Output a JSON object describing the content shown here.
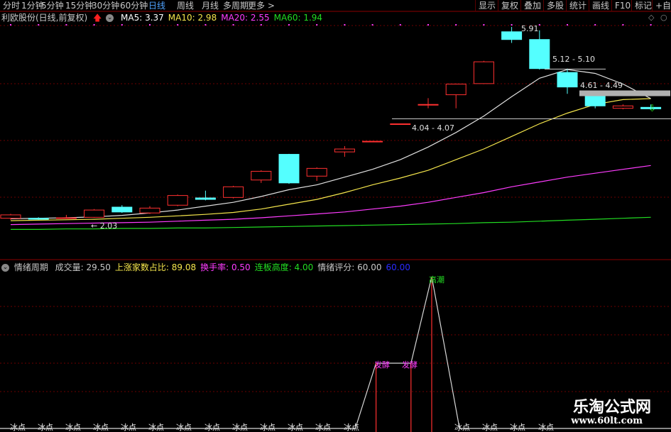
{
  "menu": {
    "tabs": [
      "分时",
      "1分钟",
      "5分钟",
      "15分钟",
      "30分钟",
      "60分钟",
      "日线",
      "周线",
      "月线",
      "多周期",
      "更多 >"
    ],
    "active_tab": "日线",
    "right_buttons": [
      "显示",
      "复权",
      "叠加",
      "多股",
      "统计",
      "画线",
      "F10",
      "标记",
      "+自选"
    ]
  },
  "main_panel": {
    "stock_name": "利欧股份(日线,前复权)",
    "ma": [
      {
        "label": "MA5: 3.37",
        "color": "#ffffff"
      },
      {
        "label": "MA10: 2.98",
        "color": "#f5e64c"
      },
      {
        "label": "MA20: 2.55",
        "color": "#ff3cff"
      },
      {
        "label": "MA60: 1.94",
        "color": "#22dd22"
      }
    ],
    "annotations": [
      "5.91",
      "5.12 - 5.10",
      "4.61 - 4.49",
      "4.04 - 4.07",
      "← 2.03"
    ]
  },
  "lower_panel": {
    "title": "情绪周期",
    "stats": [
      {
        "label": "成交量: 29.50",
        "color": "#c8c8c8"
      },
      {
        "label": "上涨家数占比: 89.08",
        "color": "#f5e64c"
      },
      {
        "label": "换手率: 0.50",
        "color": "#ff3cff"
      },
      {
        "label": "连板高度: 4.00",
        "color": "#22dd22"
      },
      {
        "label": "情绪评分: 60.00",
        "color": "#c8c8c8"
      },
      {
        "label": "60.00",
        "color": "#2a2aff"
      }
    ],
    "phase_labels": {
      "ice": "冰点",
      "ferment": "发酵",
      "climax": "高潮"
    }
  },
  "chart_data": {
    "type": "candlestick",
    "candles": [
      {
        "o": 2.03,
        "c": 2.1,
        "h": 2.12,
        "l": 2.0
      },
      {
        "o": 2.03,
        "c": 2.01,
        "h": 2.05,
        "l": 2.0
      },
      {
        "o": 2.03,
        "c": 2.04,
        "h": 2.1,
        "l": 2.02
      },
      {
        "o": 2.05,
        "c": 2.2,
        "h": 2.22,
        "l": 2.04
      },
      {
        "o": 2.26,
        "c": 2.16,
        "h": 2.3,
        "l": 2.14
      },
      {
        "o": 2.14,
        "c": 2.24,
        "h": 2.28,
        "l": 2.12
      },
      {
        "o": 2.3,
        "c": 2.5,
        "h": 2.52,
        "l": 2.28
      },
      {
        "o": 2.45,
        "c": 2.42,
        "h": 2.6,
        "l": 2.4
      },
      {
        "o": 2.46,
        "c": 2.68,
        "h": 2.7,
        "l": 2.44
      },
      {
        "o": 2.82,
        "c": 3.0,
        "h": 3.02,
        "l": 2.76
      },
      {
        "o": 3.35,
        "c": 2.76,
        "h": 3.36,
        "l": 2.74
      },
      {
        "o": 2.9,
        "c": 3.06,
        "h": 3.08,
        "l": 2.8
      },
      {
        "o": 3.4,
        "c": 3.46,
        "h": 3.52,
        "l": 3.3
      },
      {
        "o": 3.62,
        "c": 3.62,
        "h": 3.62,
        "l": 3.62
      },
      {
        "o": 3.98,
        "c": 3.98,
        "h": 3.98,
        "l": 3.98
      },
      {
        "o": 4.38,
        "c": 4.38,
        "h": 4.51,
        "l": 4.3
      },
      {
        "o": 4.58,
        "c": 4.8,
        "h": 4.81,
        "l": 4.3
      },
      {
        "o": 4.81,
        "c": 5.26,
        "h": 5.28,
        "l": 4.8
      },
      {
        "o": 5.88,
        "c": 5.72,
        "h": 5.98,
        "l": 5.65
      },
      {
        "o": 5.72,
        "c": 5.12,
        "h": 5.91,
        "l": 5.1
      },
      {
        "o": 5.04,
        "c": 4.74,
        "h": 5.12,
        "l": 4.6
      },
      {
        "o": 4.61,
        "c": 4.35,
        "h": 4.64,
        "l": 4.3
      },
      {
        "o": 4.3,
        "c": 4.35,
        "h": 4.38,
        "l": 4.28
      },
      {
        "o": 4.32,
        "c": 4.29,
        "h": 4.38,
        "l": 4.28
      }
    ],
    "ma5": [
      2.02,
      2.03,
      2.04,
      2.06,
      2.09,
      2.14,
      2.2,
      2.28,
      2.36,
      2.48,
      2.62,
      2.72,
      2.88,
      3.04,
      3.24,
      3.5,
      3.8,
      4.14,
      4.54,
      4.92,
      5.1,
      5.02,
      4.8,
      4.5
    ],
    "ma10": [
      1.98,
      1.99,
      2.0,
      2.01,
      2.03,
      2.05,
      2.08,
      2.11,
      2.15,
      2.22,
      2.32,
      2.42,
      2.56,
      2.72,
      2.86,
      3.02,
      3.24,
      3.46,
      3.72,
      3.98,
      4.2,
      4.38,
      4.48,
      4.5
    ],
    "ma20": [
      1.9,
      1.91,
      1.92,
      1.93,
      1.94,
      1.95,
      1.97,
      1.99,
      2.01,
      2.04,
      2.08,
      2.12,
      2.16,
      2.22,
      2.28,
      2.36,
      2.46,
      2.56,
      2.68,
      2.78,
      2.88,
      2.96,
      3.04,
      3.12
    ],
    "ma60": [
      1.8,
      1.8,
      1.81,
      1.81,
      1.82,
      1.82,
      1.83,
      1.83,
      1.84,
      1.85,
      1.86,
      1.87,
      1.88,
      1.89,
      1.9,
      1.91,
      1.92,
      1.94,
      1.95,
      1.97,
      1.99,
      2.01,
      2.03,
      2.05
    ],
    "sentiment": [
      0,
      0,
      0,
      0,
      0,
      0,
      0,
      0,
      0,
      0,
      0,
      0,
      0,
      1,
      1,
      2,
      0,
      0,
      0,
      0,
      0,
      0,
      0,
      0
    ]
  }
}
